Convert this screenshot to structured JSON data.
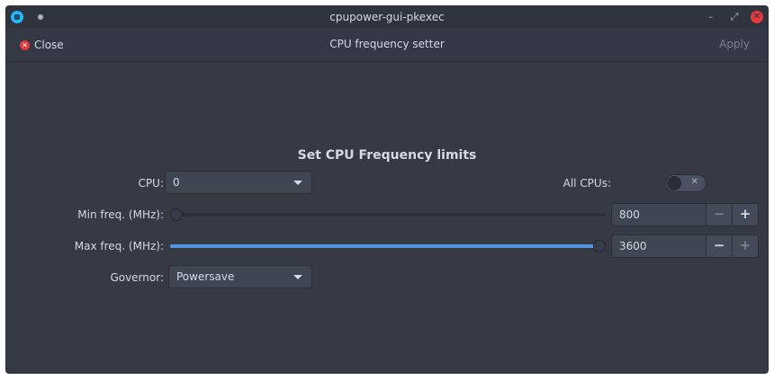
{
  "window": {
    "title": "cpupower-gui-pkexec",
    "controls": {
      "minimize": "–",
      "maximize": "⤢",
      "close": "✕"
    }
  },
  "header": {
    "close_label": "Close",
    "title": "CPU frequency setter",
    "apply_label": "Apply"
  },
  "section_title": "Set CPU Frequency limits",
  "cpu": {
    "label": "CPU:",
    "value": "0"
  },
  "all_cpus": {
    "label": "All CPUs:",
    "enabled": false,
    "off_mark": "✕"
  },
  "min_freq": {
    "label": "Min freq. (MHz):",
    "value": "800",
    "slider_fraction": 0.0
  },
  "max_freq": {
    "label": "Max freq. (MHz):",
    "value": "3600",
    "slider_fraction": 1.0
  },
  "spin_buttons": {
    "minus": "−",
    "plus": "+"
  },
  "governor": {
    "label": "Governor:",
    "value": "Powersave"
  },
  "colors": {
    "accent": "#5294e2",
    "window_bg": "#363a45",
    "close_red": "#e0393e"
  }
}
